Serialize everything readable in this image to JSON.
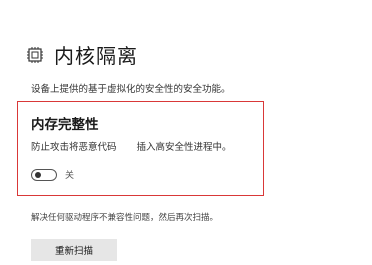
{
  "header": {
    "icon": "chip-icon",
    "title": "内核隔离"
  },
  "description": "设备上提供的基于虚拟化的安全性的安全功能。",
  "memory_integrity": {
    "title": "内存完整性",
    "desc_part1": "防止攻击将恶意代码",
    "desc_part2": "插入高安全性进程中。",
    "toggle": {
      "state": "off",
      "label": "关"
    },
    "highlight_color": "#d93838"
  },
  "note": "解决任何驱动程序不兼容性问题，然后再次扫描。",
  "rescan_button": {
    "label": "重新扫描"
  }
}
